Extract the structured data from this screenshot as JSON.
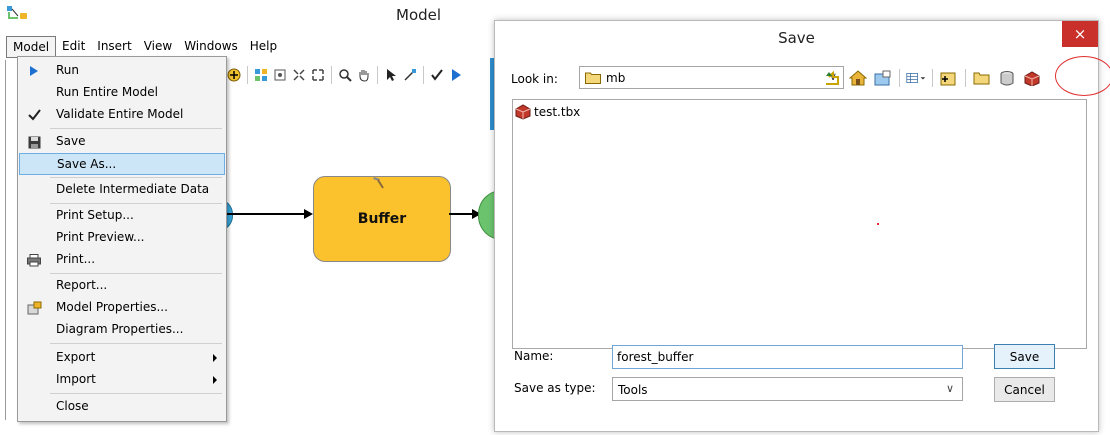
{
  "model_window": {
    "title": "Model",
    "menu": [
      "Model",
      "Edit",
      "Insert",
      "View",
      "Windows",
      "Help"
    ],
    "active_menu_index": 0,
    "dropdown_items": [
      {
        "label": "Run",
        "icon": "run-arrow-icon",
        "submenu": false,
        "highlighted": false
      },
      {
        "label": "Run Entire Model",
        "icon": "",
        "submenu": false,
        "highlighted": false
      },
      {
        "label": "Validate Entire Model",
        "icon": "checkmark-icon",
        "submenu": false,
        "highlighted": false
      },
      {
        "label": "Save",
        "icon": "floppy-disk-icon",
        "submenu": false,
        "highlighted": false
      },
      {
        "label": "Save As...",
        "icon": "",
        "submenu": false,
        "highlighted": true
      },
      {
        "label": "Delete Intermediate Data",
        "icon": "",
        "submenu": false,
        "highlighted": false
      },
      {
        "label": "Print Setup...",
        "icon": "",
        "submenu": false,
        "highlighted": false
      },
      {
        "label": "Print Preview...",
        "icon": "",
        "submenu": false,
        "highlighted": false
      },
      {
        "label": "Print...",
        "icon": "printer-icon",
        "submenu": false,
        "highlighted": false
      },
      {
        "label": "Report...",
        "icon": "",
        "submenu": false,
        "highlighted": false
      },
      {
        "label": "Model Properties...",
        "icon": "model-properties-icon",
        "submenu": false,
        "highlighted": false
      },
      {
        "label": "Diagram Properties...",
        "icon": "",
        "submenu": false,
        "highlighted": false
      },
      {
        "label": "Export",
        "icon": "",
        "submenu": true,
        "highlighted": false
      },
      {
        "label": "Import",
        "icon": "",
        "submenu": true,
        "highlighted": false
      },
      {
        "label": "Close",
        "icon": "",
        "submenu": false,
        "highlighted": false
      }
    ],
    "diagram": {
      "tool_label": "Buffer",
      "tool_color": "#fcc22e",
      "input_color": "#39a6da",
      "output_color": "#6bc46d"
    }
  },
  "save_dialog": {
    "title": "Save",
    "close_label": "×",
    "look_in_label": "Look in:",
    "look_in_value": "mb",
    "files": [
      "test.tbx"
    ],
    "name_label": "Name:",
    "name_value": "forest_buffer",
    "type_label": "Save as type:",
    "type_value": "Tools",
    "save_button": "Save",
    "cancel_button": "Cancel",
    "annotation_color": "#e03030"
  }
}
